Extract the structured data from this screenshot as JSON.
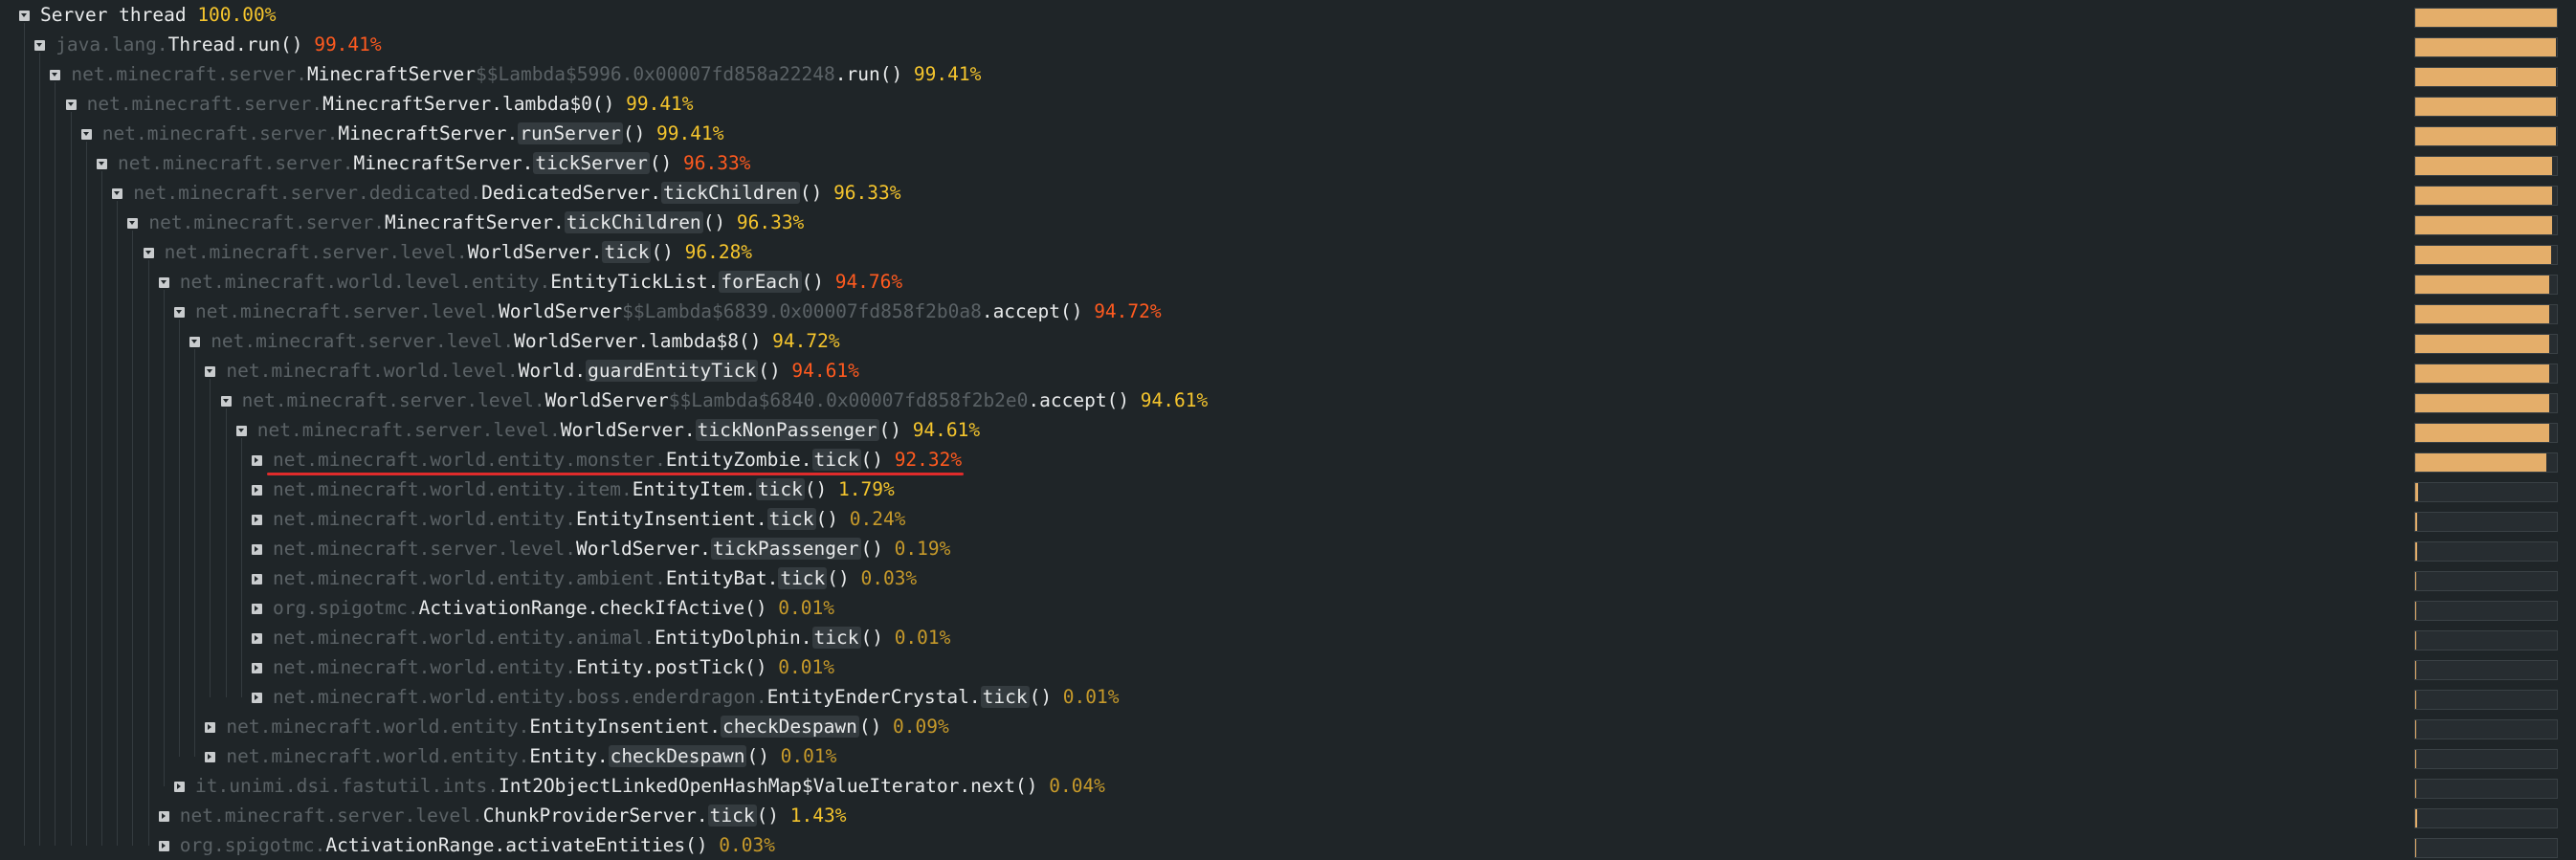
{
  "colors": {
    "background": "#1f2528",
    "package": "#5b6266",
    "class": "#e8eaeb",
    "bar_fill": "#e4ae6a",
    "pct_high": "#ff5a1f",
    "pct_mid": "#f5c52d",
    "pct_low": "#c79a2a",
    "highlight_underline": "#e02b2b"
  },
  "icons": {
    "expanded": "chevron-down-icon",
    "collapsed": "chevron-right-icon"
  },
  "nodes": [
    {
      "depth": 0,
      "expanded": true,
      "pkg": "",
      "cls": "Server thread",
      "lam": "",
      "sep": "",
      "meth": "",
      "args": "",
      "pct": "100.00%",
      "pct_level": "mid",
      "share": 1.0
    },
    {
      "depth": 1,
      "expanded": true,
      "pkg": "java.lang.",
      "cls": "Thread",
      "lam": "",
      "sep": ".",
      "meth": "run",
      "args": "()",
      "pct": "99.41%",
      "pct_level": "high",
      "share": 0.9941,
      "plain_meth": true
    },
    {
      "depth": 2,
      "expanded": true,
      "pkg": "net.minecraft.server.",
      "cls": "MinecraftServer",
      "lam": "$$Lambda$5996.0x00007fd858a22248",
      "sep": ".",
      "meth": "run",
      "args": "()",
      "pct": "99.41%",
      "pct_level": "mid",
      "share": 0.9941,
      "plain_meth": true
    },
    {
      "depth": 3,
      "expanded": true,
      "pkg": "net.minecraft.server.",
      "cls": "MinecraftServer",
      "lam": "",
      "sep": ".",
      "meth": "lambda$0",
      "args": "()",
      "pct": "99.41%",
      "pct_level": "mid",
      "share": 0.9941,
      "plain_meth": true
    },
    {
      "depth": 4,
      "expanded": true,
      "pkg": "net.minecraft.server.",
      "cls": "MinecraftServer",
      "lam": "",
      "sep": ".",
      "meth": "runServer",
      "args": "()",
      "pct": "99.41%",
      "pct_level": "mid",
      "share": 0.9941
    },
    {
      "depth": 5,
      "expanded": true,
      "pkg": "net.minecraft.server.",
      "cls": "MinecraftServer",
      "lam": "",
      "sep": ".",
      "meth": "tickServer",
      "args": "()",
      "pct": "96.33%",
      "pct_level": "high",
      "share": 0.9633
    },
    {
      "depth": 6,
      "expanded": true,
      "pkg": "net.minecraft.server.dedicated.",
      "cls": "DedicatedServer",
      "lam": "",
      "sep": ".",
      "meth": "tickChildren",
      "args": "()",
      "pct": "96.33%",
      "pct_level": "mid",
      "share": 0.9633
    },
    {
      "depth": 7,
      "expanded": true,
      "pkg": "net.minecraft.server.",
      "cls": "MinecraftServer",
      "lam": "",
      "sep": ".",
      "meth": "tickChildren",
      "args": "()",
      "pct": "96.33%",
      "pct_level": "mid",
      "share": 0.9633
    },
    {
      "depth": 8,
      "expanded": true,
      "pkg": "net.minecraft.server.level.",
      "cls": "WorldServer",
      "lam": "",
      "sep": ".",
      "meth": "tick",
      "args": "()",
      "pct": "96.28%",
      "pct_level": "mid",
      "share": 0.9628
    },
    {
      "depth": 9,
      "expanded": true,
      "pkg": "net.minecraft.world.level.entity.",
      "cls": "EntityTickList",
      "lam": "",
      "sep": ".",
      "meth": "forEach",
      "args": "()",
      "pct": "94.76%",
      "pct_level": "high",
      "share": 0.9476
    },
    {
      "depth": 10,
      "expanded": true,
      "pkg": "net.minecraft.server.level.",
      "cls": "WorldServer",
      "lam": "$$Lambda$6839.0x00007fd858f2b0a8",
      "sep": ".",
      "meth": "accept",
      "args": "()",
      "pct": "94.72%",
      "pct_level": "high",
      "share": 0.9472,
      "plain_meth": true
    },
    {
      "depth": 11,
      "expanded": true,
      "pkg": "net.minecraft.server.level.",
      "cls": "WorldServer",
      "lam": "",
      "sep": ".",
      "meth": "lambda$8",
      "args": "()",
      "pct": "94.72%",
      "pct_level": "mid",
      "share": 0.9472,
      "plain_meth": true
    },
    {
      "depth": 12,
      "expanded": true,
      "pkg": "net.minecraft.world.level.",
      "cls": "World",
      "lam": "",
      "sep": ".",
      "meth": "guardEntityTick",
      "args": "()",
      "pct": "94.61%",
      "pct_level": "high",
      "share": 0.9461
    },
    {
      "depth": 13,
      "expanded": true,
      "pkg": "net.minecraft.server.level.",
      "cls": "WorldServer",
      "lam": "$$Lambda$6840.0x00007fd858f2b2e0",
      "sep": ".",
      "meth": "accept",
      "args": "()",
      "pct": "94.61%",
      "pct_level": "mid",
      "share": 0.9461,
      "plain_meth": true
    },
    {
      "depth": 14,
      "expanded": true,
      "pkg": "net.minecraft.server.level.",
      "cls": "WorldServer",
      "lam": "",
      "sep": ".",
      "meth": "tickNonPassenger",
      "args": "()",
      "pct": "94.61%",
      "pct_level": "mid",
      "share": 0.9461
    },
    {
      "depth": 15,
      "expanded": false,
      "pkg": "net.minecraft.world.entity.monster.",
      "cls": "EntityZombie",
      "lam": "",
      "sep": ".",
      "meth": "tick",
      "args": "()",
      "pct": "92.32%",
      "pct_level": "high",
      "share": 0.9232,
      "underline": true
    },
    {
      "depth": 15,
      "expanded": false,
      "pkg": "net.minecraft.world.entity.item.",
      "cls": "EntityItem",
      "lam": "",
      "sep": ".",
      "meth": "tick",
      "args": "()",
      "pct": "1.79%",
      "pct_level": "mid",
      "share": 0.0179
    },
    {
      "depth": 15,
      "expanded": false,
      "pkg": "net.minecraft.world.entity.",
      "cls": "EntityInsentient",
      "lam": "",
      "sep": ".",
      "meth": "tick",
      "args": "()",
      "pct": "0.24%",
      "pct_level": "low",
      "share": 0.0024
    },
    {
      "depth": 15,
      "expanded": false,
      "pkg": "net.minecraft.server.level.",
      "cls": "WorldServer",
      "lam": "",
      "sep": ".",
      "meth": "tickPassenger",
      "args": "()",
      "pct": "0.19%",
      "pct_level": "low",
      "share": 0.0019
    },
    {
      "depth": 15,
      "expanded": false,
      "pkg": "net.minecraft.world.entity.ambient.",
      "cls": "EntityBat",
      "lam": "",
      "sep": ".",
      "meth": "tick",
      "args": "()",
      "pct": "0.03%",
      "pct_level": "low",
      "share": 0.0003
    },
    {
      "depth": 15,
      "expanded": false,
      "pkg": "org.spigotmc.",
      "cls": "ActivationRange",
      "lam": "",
      "sep": ".",
      "meth": "checkIfActive",
      "args": "()",
      "pct": "0.01%",
      "pct_level": "low",
      "share": 0.0001,
      "plain_meth": true
    },
    {
      "depth": 15,
      "expanded": false,
      "pkg": "net.minecraft.world.entity.animal.",
      "cls": "EntityDolphin",
      "lam": "",
      "sep": ".",
      "meth": "tick",
      "args": "()",
      "pct": "0.01%",
      "pct_level": "low",
      "share": 0.0001
    },
    {
      "depth": 15,
      "expanded": false,
      "pkg": "net.minecraft.world.entity.",
      "cls": "Entity",
      "lam": "",
      "sep": ".",
      "meth": "postTick",
      "args": "()",
      "pct": "0.01%",
      "pct_level": "low",
      "share": 0.0001,
      "plain_meth": true
    },
    {
      "depth": 15,
      "expanded": false,
      "pkg": "net.minecraft.world.entity.boss.enderdragon.",
      "cls": "EntityEnderCrystal",
      "lam": "",
      "sep": ".",
      "meth": "tick",
      "args": "()",
      "pct": "0.01%",
      "pct_level": "low",
      "share": 0.0001
    },
    {
      "depth": 12,
      "expanded": false,
      "pkg": "net.minecraft.world.entity.",
      "cls": "EntityInsentient",
      "lam": "",
      "sep": ".",
      "meth": "checkDespawn",
      "args": "()",
      "pct": "0.09%",
      "pct_level": "low",
      "share": 0.0009
    },
    {
      "depth": 12,
      "expanded": false,
      "pkg": "net.minecraft.world.entity.",
      "cls": "Entity",
      "lam": "",
      "sep": ".",
      "meth": "checkDespawn",
      "args": "()",
      "pct": "0.01%",
      "pct_level": "low",
      "share": 0.0001
    },
    {
      "depth": 10,
      "expanded": false,
      "pkg": "it.unimi.dsi.fastutil.ints.",
      "cls": "Int2ObjectLinkedOpenHashMap$ValueIterator",
      "lam": "",
      "sep": ".",
      "meth": "next",
      "args": "()",
      "pct": "0.04%",
      "pct_level": "low",
      "share": 0.0004,
      "plain_meth": true
    },
    {
      "depth": 9,
      "expanded": false,
      "pkg": "net.minecraft.server.level.",
      "cls": "ChunkProviderServer",
      "lam": "",
      "sep": ".",
      "meth": "tick",
      "args": "()",
      "pct": "1.43%",
      "pct_level": "mid",
      "share": 0.0143
    },
    {
      "depth": 9,
      "expanded": false,
      "pkg": "org.spigotmc.",
      "cls": "ActivationRange",
      "lam": "",
      "sep": ".",
      "meth": "activateEntities",
      "args": "()",
      "pct": "0.03%",
      "pct_level": "low",
      "share": 0.0003,
      "plain_meth": true
    }
  ]
}
